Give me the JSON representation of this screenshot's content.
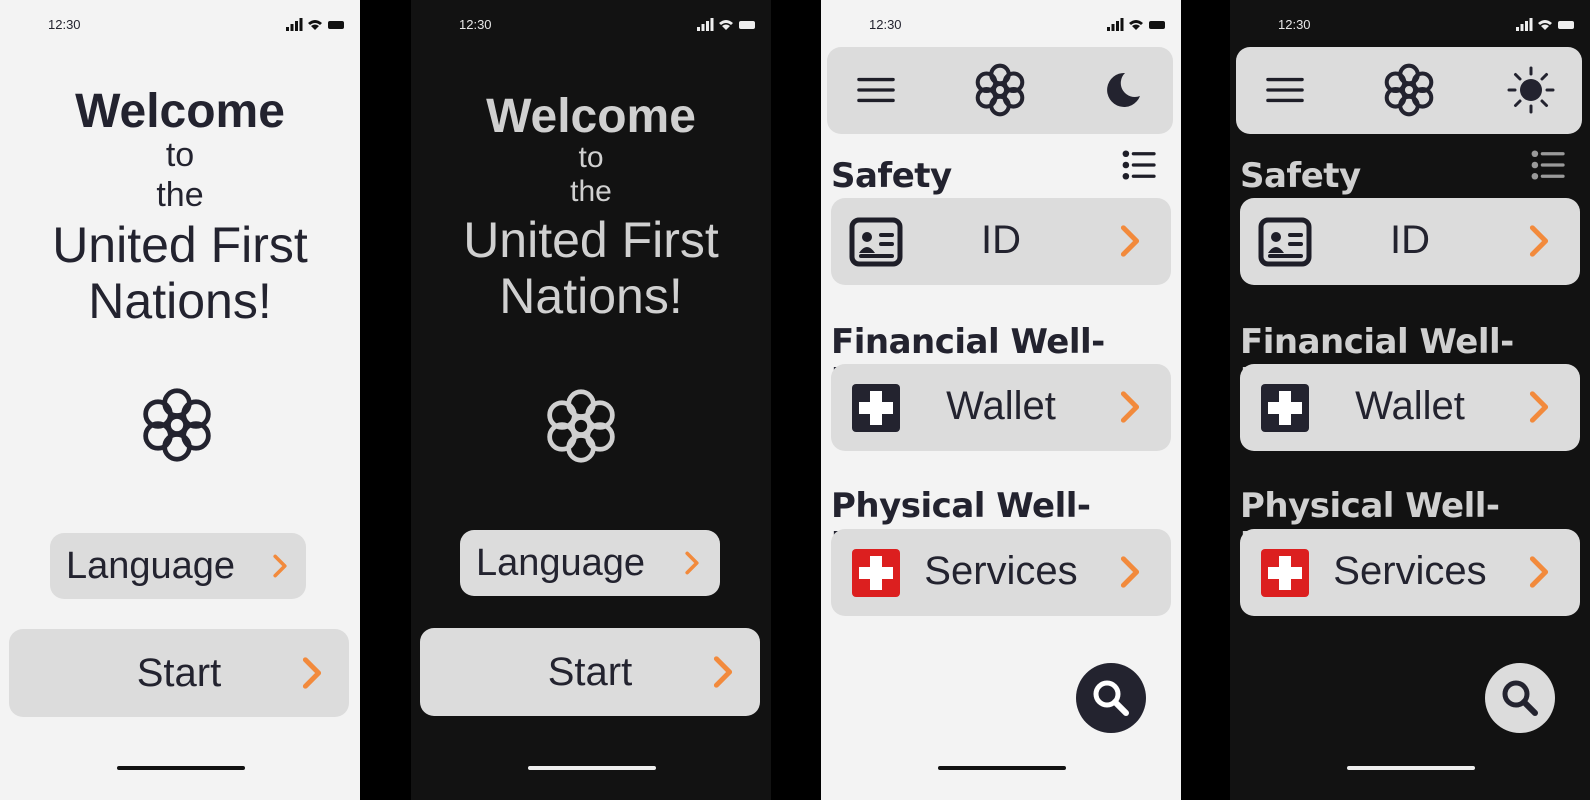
{
  "status_bar": {
    "time": "12:30"
  },
  "welcome_screen": {
    "line1": "Welcome",
    "line2": "to",
    "line3": "the",
    "line4": "United First",
    "line5": "Nations!",
    "language_label": "Language",
    "start_label": "Start"
  },
  "home_screen": {
    "sections": [
      {
        "title": "Safety",
        "card_label": "ID",
        "icon": "id-card-icon"
      },
      {
        "title": "Financial Well-being",
        "card_label": "Wallet",
        "icon": "wallet-cross-icon"
      },
      {
        "title": "Physical Well-being",
        "card_label": "Services",
        "icon": "medical-cross-icon"
      }
    ],
    "theme_toggle_light_mode": "moon-icon",
    "theme_toggle_dark_mode": "sun-icon"
  },
  "colors": {
    "accent_chevron": "#f28a3c",
    "light_bg": "#f3f3f3",
    "dark_bg": "#121212",
    "card_bg": "#dcdcdc",
    "ink": "#23232f",
    "medical_red": "#dc1f1f"
  }
}
